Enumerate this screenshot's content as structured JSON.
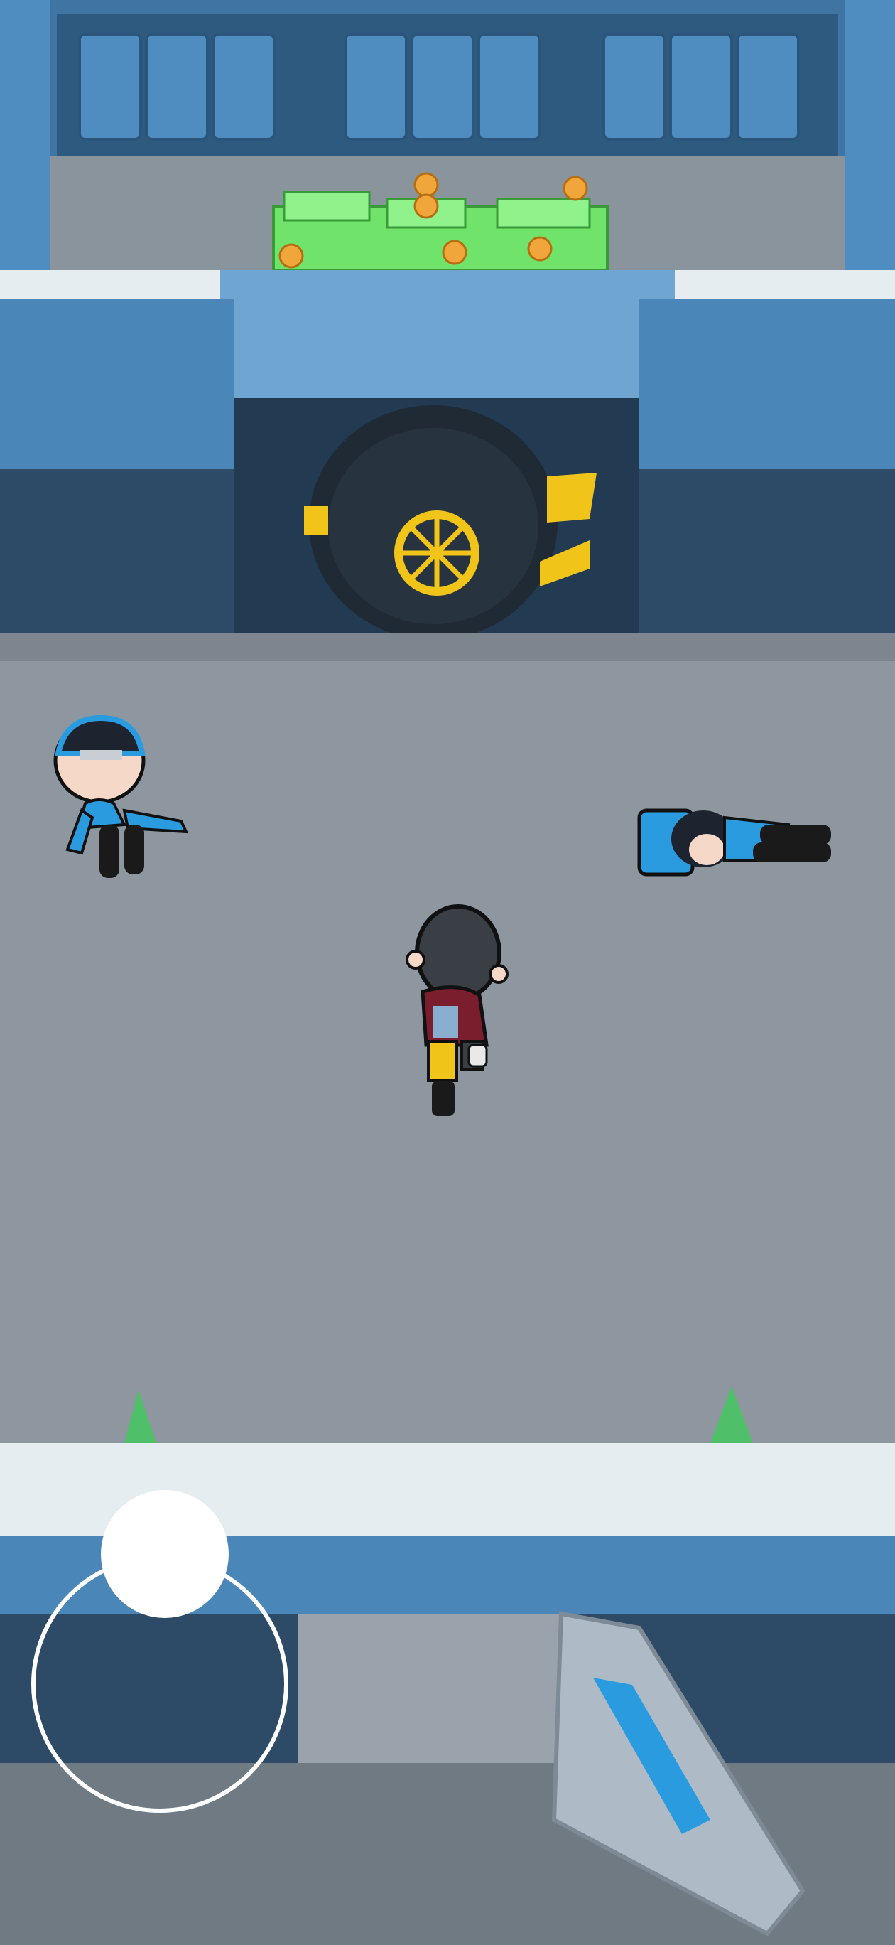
{
  "game": {
    "scene": "bank-vault-heist",
    "colors": {
      "floor": "#8e979f",
      "wall_front": "#4a87b8",
      "wall_top": "#e6edf1",
      "wall_shadow": "#2d4a66",
      "vault_door": "#1f2a35",
      "vault_gold": "#f0c419",
      "cash_green": "#6fe36a",
      "guard_blue": "#2b9be0",
      "player_shirt": "#7a1d2c"
    },
    "icons": {
      "vault_wheel": "ship-wheel-icon",
      "joystick": "virtual-joystick"
    }
  },
  "controls": {
    "joystick": {
      "state": "idle"
    }
  }
}
